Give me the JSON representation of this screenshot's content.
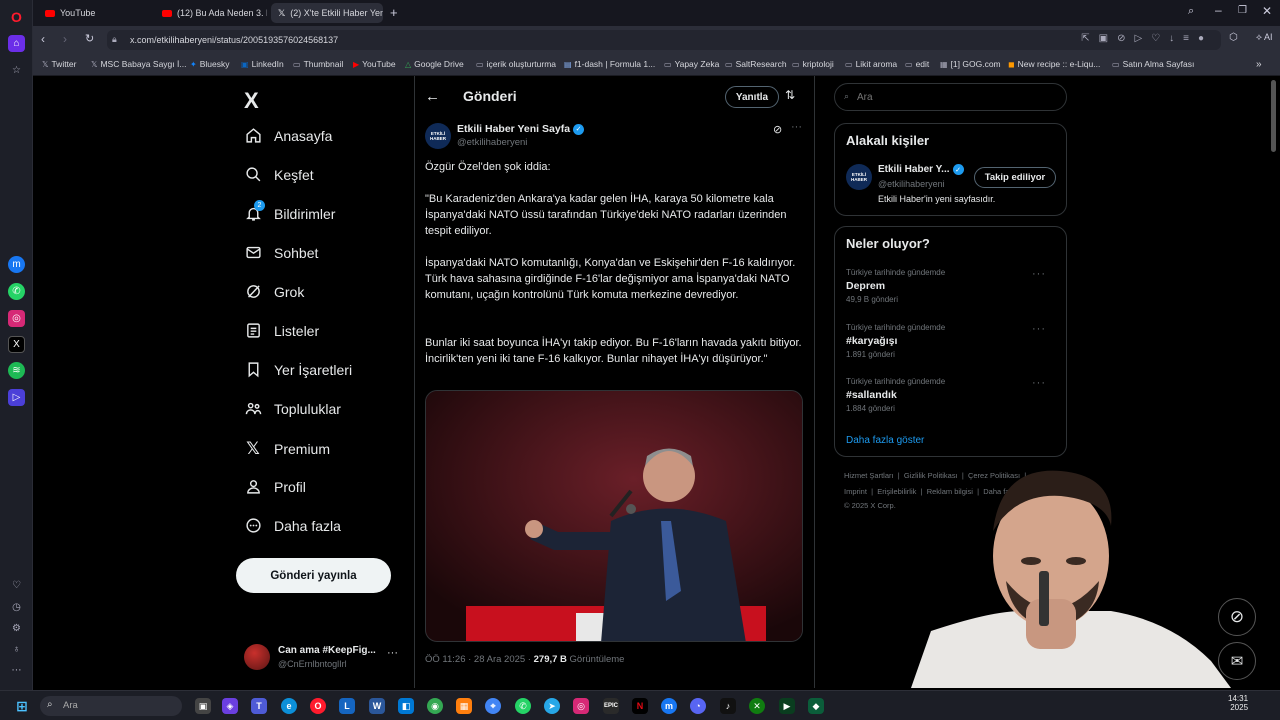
{
  "browser": {
    "tabs": [
      {
        "label": "YouTube"
      },
      {
        "label": "(12) Bu Ada Neden 3. Dün"
      },
      {
        "label": "(2) X'te Etkili Haber Yeni S"
      }
    ],
    "url": "x.com/etkilihaberyeni/status/2005193576024568137",
    "ai_label": "AI",
    "bookmarks": [
      "Twitter",
      "MSC Babaya Saygı İ...",
      "Bluesky",
      "LinkedIn",
      "Thumbnail",
      "YouTube",
      "Google Drive",
      "içerik oluşturturma",
      "f1-dash | Formula 1...",
      "Yapay Zeka",
      "SaltResearch",
      "kriptoloji",
      "Likit aroma",
      "edit",
      "[1] GOG.com",
      "New recipe :: e-Liqu...",
      "Satın Alma Sayfası"
    ]
  },
  "nav": {
    "logo": "X",
    "items": [
      {
        "label": "Anasayfa",
        "icon": "home-icon"
      },
      {
        "label": "Keşfet",
        "icon": "search-icon"
      },
      {
        "label": "Bildirimler",
        "icon": "bell-icon",
        "badge": "2"
      },
      {
        "label": "Sohbet",
        "icon": "mail-icon"
      },
      {
        "label": "Grok",
        "icon": "grok-icon"
      },
      {
        "label": "Listeler",
        "icon": "list-icon"
      },
      {
        "label": "Yer İşaretleri",
        "icon": "bookmark-icon"
      },
      {
        "label": "Topluluklar",
        "icon": "people-icon"
      },
      {
        "label": "Premium",
        "icon": "x-icon"
      },
      {
        "label": "Profil",
        "icon": "user-icon"
      },
      {
        "label": "Daha fazla",
        "icon": "more-icon"
      }
    ],
    "post_button": "Gönderi yayınla",
    "account": {
      "name": "Can ama #KeepFig...",
      "handle": "@CnErnlbntoglIrl"
    }
  },
  "main": {
    "header": {
      "title": "Gönderi",
      "reply": "Yanıtla"
    },
    "tweet": {
      "author": "Etkili Haber Yeni Sayfa",
      "handle": "@etkilihaberyeni",
      "avatar_text": "ETKİLİ HABER",
      "paragraphs": [
        "Özgür Özel'den şok iddia:",
        "\"Bu Karadeniz'den Ankara'ya kadar gelen İHA, karaya 50 kilometre kala İspanya'daki NATO üssü tarafından Türkiye'deki NATO radarları üzerinden tespit ediliyor.",
        "İspanya'daki NATO komutanlığı, Konya'dan ve Eskişehir'den F-16 kaldırıyor. Türk hava sahasına girdiğinde F-16'lar değişmiyor ama İspanya'daki NATO komutanı, uçağın kontrolünü Türk komuta merkezine devrediyor.",
        "Bunlar iki saat boyunca İHA'yı takip ediyor. Bu F-16'ların havada yakıtı bitiyor. İncirlik'ten yeni iki tane F-16 kalkıyor. Bunlar nihayet İHA'yı düşürüyor.\""
      ],
      "meta": "ÖÖ 11:26 · 28 Ara 2025 · ",
      "views": "279,7 B",
      "views_label": "Görüntüleme"
    }
  },
  "right": {
    "search_placeholder": "Ara",
    "related": {
      "title": "Alakalı kişiler",
      "name": "Etkili Haber Y...",
      "handle": "@etkilihaberyeni",
      "bio": "Etkili Haber'in yeni sayfasıdır.",
      "follow": "Takip ediliyor"
    },
    "trends": {
      "title": "Neler oluyor?",
      "items": [
        {
          "sub": "Türkiye tarihinde gündemde",
          "title": "Deprem",
          "count": "49,9 B gönderi"
        },
        {
          "sub": "Türkiye tarihinde gündemde",
          "title": "#karyağışı",
          "count": "1.891 gönderi"
        },
        {
          "sub": "Türkiye tarihinde gündemde",
          "title": "#sallandık",
          "count": "1.884 gönderi"
        }
      ],
      "more": "Daha fazla göster"
    },
    "footer": {
      "row1": [
        "Hizmet Şartları",
        "Gizlilik Politikası",
        "Çerez Politikası"
      ],
      "row2": [
        "Imprint",
        "Erişilebilirlik",
        "Reklam bilgisi",
        "Daha fazla ..."
      ],
      "copyright": "© 2025 X Corp."
    }
  },
  "taskbar": {
    "search": "Ara",
    "time": "14:31",
    "date": "2025"
  },
  "colors": {
    "accent": "#1d9bf0",
    "verified": "#1d9bf0",
    "opera_red": "#ff1b2d",
    "youtube_red": "#ff0000"
  }
}
